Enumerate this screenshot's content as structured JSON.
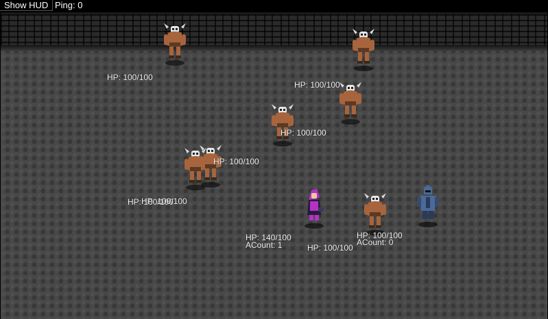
{
  "topbar": {
    "hud_button": "Show HUD",
    "ping": "Ping: 0"
  },
  "labels": [
    {
      "name": "hp-label-minotaur-1",
      "text": "HP: 100/100"
    },
    {
      "name": "hp-label-minotaur-2",
      "text": "HP: 100/100"
    },
    {
      "name": "hp-label-minotaur-3",
      "text": "HP: 100/100"
    },
    {
      "name": "hp-label-minotaur-4",
      "text": "HP: 100/100"
    },
    {
      "name": "hp-label-minotaur-5",
      "text": "HP: 100/100"
    },
    {
      "name": "hp-label-minotaur-6",
      "text": "HP: 100/100"
    },
    {
      "name": "hp-label-player",
      "text": "HP: 140/100"
    },
    {
      "name": "acount-label-player",
      "text": "ACount: 1"
    },
    {
      "name": "hp-label-minotaur-7",
      "text": "HP: 100/100"
    },
    {
      "name": "hp-label-minotaur-8",
      "text": "HP: 100/100"
    },
    {
      "name": "acount-label-ally",
      "text": "ACount: 0"
    },
    {
      "name": "hp-label-minotaur-9",
      "text": "HP: 100/100"
    }
  ],
  "entities": [
    {
      "name": "minotaur-enemy",
      "kind": "minotaur-icon"
    },
    {
      "name": "minotaur-enemy",
      "kind": "minotaur-icon"
    },
    {
      "name": "minotaur-enemy",
      "kind": "minotaur-icon"
    },
    {
      "name": "minotaur-enemy",
      "kind": "minotaur-icon"
    },
    {
      "name": "minotaur-enemy",
      "kind": "minotaur-icon"
    },
    {
      "name": "minotaur-enemy",
      "kind": "minotaur-icon"
    },
    {
      "name": "minotaur-enemy",
      "kind": "minotaur-icon"
    },
    {
      "name": "player-character",
      "kind": "purple-mage-icon"
    },
    {
      "name": "ally-knight",
      "kind": "blue-knight-icon"
    }
  ],
  "colors": {
    "minotaur_skin": "#a8643c",
    "player": "#b432c8",
    "ally": "#4a6a9a",
    "floor": "#484848"
  }
}
